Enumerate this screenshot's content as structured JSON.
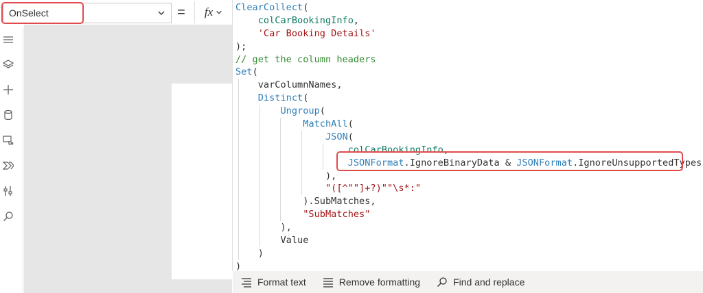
{
  "formula_bar": {
    "property": "OnSelect",
    "equals": "=",
    "fx_label": "fx"
  },
  "rail": {
    "icons": [
      "hamburger-icon",
      "layers-icon",
      "plus-icon",
      "database-icon",
      "media-icon",
      "power-automate-icon",
      "tools-icon",
      "search-icon"
    ]
  },
  "code_lines": [
    {
      "indent": 0,
      "guides": [],
      "parts": [
        {
          "t": "fn",
          "v": "ClearCollect"
        },
        {
          "t": "",
          "v": "("
        }
      ]
    },
    {
      "indent": 4,
      "guides": [],
      "parts": [
        {
          "t": "tbl",
          "v": "colCarBookingInfo"
        },
        {
          "t": "",
          "v": ","
        }
      ]
    },
    {
      "indent": 4,
      "guides": [],
      "parts": [
        {
          "t": "str",
          "v": "'Car Booking Details'"
        }
      ]
    },
    {
      "indent": 0,
      "guides": [],
      "parts": [
        {
          "t": "",
          "v": ");"
        }
      ]
    },
    {
      "indent": 0,
      "guides": [],
      "parts": [
        {
          "t": "cmt",
          "v": "// get the column headers"
        }
      ]
    },
    {
      "indent": 0,
      "guides": [],
      "parts": [
        {
          "t": "kw",
          "v": "Set"
        },
        {
          "t": "",
          "v": "("
        }
      ]
    },
    {
      "indent": 4,
      "guides": [
        0
      ],
      "parts": [
        {
          "t": "",
          "v": "varColumnNames,"
        }
      ]
    },
    {
      "indent": 4,
      "guides": [
        0
      ],
      "parts": [
        {
          "t": "fn",
          "v": "Distinct"
        },
        {
          "t": "",
          "v": "("
        }
      ]
    },
    {
      "indent": 8,
      "guides": [
        0,
        4
      ],
      "parts": [
        {
          "t": "fn",
          "v": "Ungroup"
        },
        {
          "t": "",
          "v": "("
        }
      ]
    },
    {
      "indent": 12,
      "guides": [
        0,
        4,
        8
      ],
      "parts": [
        {
          "t": "fn",
          "v": "MatchAll"
        },
        {
          "t": "",
          "v": "("
        }
      ]
    },
    {
      "indent": 16,
      "guides": [
        0,
        4,
        8,
        12
      ],
      "parts": [
        {
          "t": "fn",
          "v": "JSON"
        },
        {
          "t": "",
          "v": "("
        }
      ]
    },
    {
      "indent": 20,
      "guides": [
        0,
        4,
        8,
        12,
        16
      ],
      "parts": [
        {
          "t": "tbl",
          "v": "colCarBookingInfo"
        },
        {
          "t": "",
          "v": ","
        }
      ]
    },
    {
      "indent": 20,
      "guides": [
        0,
        4,
        8,
        12,
        16
      ],
      "parts": [
        {
          "t": "fn",
          "v": "JSONFormat"
        },
        {
          "t": "",
          "v": ".IgnoreBinaryData & "
        },
        {
          "t": "fn",
          "v": "JSONFormat"
        },
        {
          "t": "",
          "v": ".IgnoreUnsupportedTypes"
        }
      ]
    },
    {
      "indent": 16,
      "guides": [
        0,
        4,
        8,
        12
      ],
      "parts": [
        {
          "t": "",
          "v": "),"
        }
      ]
    },
    {
      "indent": 16,
      "guides": [
        0,
        4,
        8,
        12
      ],
      "parts": [
        {
          "t": "str",
          "v": "\"([^\"\"]+?)\"\"\\s*:\""
        }
      ]
    },
    {
      "indent": 12,
      "guides": [
        0,
        4,
        8
      ],
      "parts": [
        {
          "t": "",
          "v": ").SubMatches,"
        }
      ]
    },
    {
      "indent": 12,
      "guides": [
        0,
        4,
        8
      ],
      "parts": [
        {
          "t": "str",
          "v": "\"SubMatches\""
        }
      ]
    },
    {
      "indent": 8,
      "guides": [
        0,
        4
      ],
      "parts": [
        {
          "t": "",
          "v": "),"
        }
      ]
    },
    {
      "indent": 8,
      "guides": [
        0,
        4
      ],
      "parts": [
        {
          "t": "",
          "v": "Value"
        }
      ]
    },
    {
      "indent": 4,
      "guides": [
        0
      ],
      "parts": [
        {
          "t": "",
          "v": ")"
        }
      ]
    },
    {
      "indent": 0,
      "guides": [],
      "parts": [
        {
          "t": "",
          "v": ")"
        }
      ]
    }
  ],
  "toolbar": {
    "format_text": "Format text",
    "remove_formatting": "Remove formatting",
    "find_replace": "Find and replace"
  },
  "colors": {
    "highlight": "#e04a4a",
    "function": "#2e7fb8",
    "table": "#0d7a61",
    "string": "#a31515",
    "comment": "#2f8a2f"
  }
}
